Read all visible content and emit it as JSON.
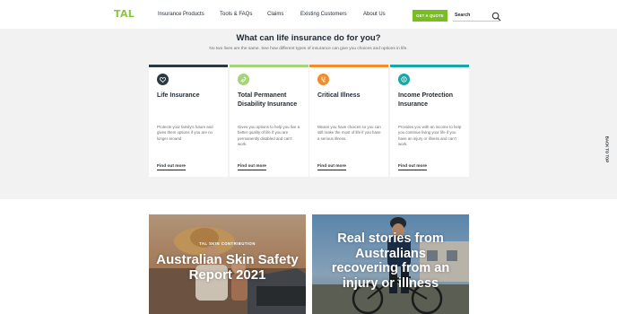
{
  "brand": {
    "logo": "TAL",
    "accent": "#78be20"
  },
  "nav": {
    "items": [
      {
        "label": "Insurance Products"
      },
      {
        "label": "Tools & FAQs"
      },
      {
        "label": "Claims"
      },
      {
        "label": "Existing Customers"
      },
      {
        "label": "About Us"
      }
    ],
    "quote_button": "GET A QUOTE",
    "search_label": "Search",
    "search_icon": "search-icon"
  },
  "section": {
    "title": "What can life insurance do for you?",
    "subtitle": "No two lives are the same. See how different types of insurance can give you choices and options in life."
  },
  "cards": [
    {
      "title": "Life Insurance",
      "desc": "Protects your family's future and gives them options if you are no longer around",
      "link": "Find out more",
      "color": "#2b3a42",
      "icon": "heart-icon"
    },
    {
      "title": "Total Permanent Disability Insurance",
      "desc": "Gives you options to help you live a better quality of life if you are permanently disabled and can't work.",
      "link": "Find out more",
      "color": "#8cc63f",
      "icon": "hand-icon"
    },
    {
      "title": "Critical Illness",
      "desc": "Means you have choices so you can still make the most of life if you have a serious illness.",
      "link": "Find out more",
      "color": "#f28c28",
      "icon": "medical-icon"
    },
    {
      "title": "Income Protection Insurance",
      "desc": "Provides you with an income to help you continue living your life if you have an injury or illness and can't work.",
      "link": "Find out more",
      "color": "#17a7a7",
      "icon": "coin-icon"
    }
  ],
  "back_to_top": "BACK TO TOP",
  "tiles": [
    {
      "kicker": "TAL SKIN CONTRIBUTION",
      "headline": "Australian Skin Safety Report 2021"
    },
    {
      "kicker": "",
      "headline": "Real stories from Australians recovering from an injury or illness"
    }
  ]
}
